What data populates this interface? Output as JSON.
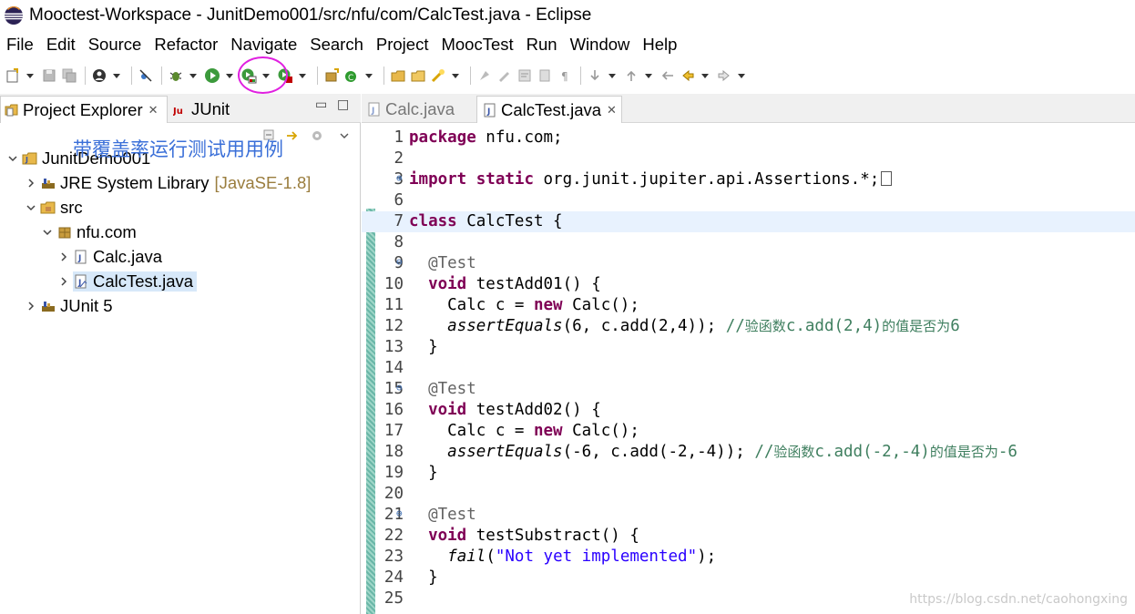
{
  "window": {
    "title": "Mooctest-Workspace - JunitDemo001/src/nfu/com/CalcTest.java - Eclipse"
  },
  "menu": [
    "File",
    "Edit",
    "Source",
    "Refactor",
    "Navigate",
    "Search",
    "Project",
    "MoocTest",
    "Run",
    "Window",
    "Help"
  ],
  "left_view": {
    "tabs": {
      "project_explorer": "Project Explorer",
      "junit": "JUnit"
    },
    "annotation": "带覆盖率运行测试用用例",
    "tree": {
      "project": "JunitDemo001",
      "jre": "JRE System Library",
      "jre_decor": "[JavaSE-1.8]",
      "src": "src",
      "package": "nfu.com",
      "file1": "Calc.java",
      "file2": "CalcTest.java",
      "junit5": "JUnit 5"
    }
  },
  "editor": {
    "tabs": {
      "calc": "Calc.java",
      "calctest": "CalcTest.java"
    },
    "lines": [
      {
        "n": "1",
        "fold": "",
        "t": [
          [
            "kw",
            "package"
          ],
          [
            "",
            "  nfu.com;"
          ]
        ]
      },
      {
        "n": "2",
        "fold": "",
        "t": []
      },
      {
        "n": "3",
        "fold": "⊕",
        "t": [
          [
            "kw",
            "import"
          ],
          [
            "",
            "  "
          ],
          [
            "kw",
            "static"
          ],
          [
            "",
            "  org.junit.jupiter.api.Assertions.*;"
          ]
        ],
        "marker": true
      },
      {
        "n": "6",
        "fold": "",
        "t": []
      },
      {
        "n": "7",
        "fold": "",
        "t": [
          [
            "kw",
            "class"
          ],
          [
            "",
            "  CalcTest {"
          ]
        ],
        "current": true
      },
      {
        "n": "8",
        "fold": "",
        "t": []
      },
      {
        "n": "9",
        "fold": "⊖",
        "t": [
          [
            "",
            "    "
          ],
          [
            "ann",
            "@Test"
          ]
        ]
      },
      {
        "n": "10",
        "fold": "",
        "t": [
          [
            "",
            "    "
          ],
          [
            "kw",
            "void"
          ],
          [
            "",
            "  testAdd01() {"
          ]
        ]
      },
      {
        "n": "11",
        "fold": "",
        "t": [
          [
            "",
            "        Calc c = "
          ],
          [
            "kw",
            "new"
          ],
          [
            "",
            "  Calc();"
          ]
        ]
      },
      {
        "n": "12",
        "fold": "",
        "t": [
          [
            "",
            "        "
          ],
          [
            "it",
            "assertEquals"
          ],
          [
            "",
            "(6, c.add(2,4));  "
          ],
          [
            "cm",
            "//"
          ],
          [
            "cm cm-cjk",
            "验函数"
          ],
          [
            "cm",
            "c.add(2,4)"
          ],
          [
            "cm cm-cjk",
            "的值是否为"
          ],
          [
            "cm",
            "6"
          ]
        ]
      },
      {
        "n": "13",
        "fold": "",
        "t": [
          [
            "",
            "    }"
          ]
        ]
      },
      {
        "n": "14",
        "fold": "",
        "t": []
      },
      {
        "n": "15",
        "fold": "⊖",
        "t": [
          [
            "",
            "    "
          ],
          [
            "ann",
            "@Test"
          ]
        ]
      },
      {
        "n": "16",
        "fold": "",
        "t": [
          [
            "",
            "    "
          ],
          [
            "kw",
            "void"
          ],
          [
            "",
            "  testAdd02() {"
          ]
        ]
      },
      {
        "n": "17",
        "fold": "",
        "t": [
          [
            "",
            "        Calc c = "
          ],
          [
            "kw",
            "new"
          ],
          [
            "",
            "  Calc();"
          ]
        ]
      },
      {
        "n": "18",
        "fold": "",
        "t": [
          [
            "",
            "        "
          ],
          [
            "it",
            "assertEquals"
          ],
          [
            "",
            "(-6, c.add(-2,-4));  "
          ],
          [
            "cm",
            "//"
          ],
          [
            "cm cm-cjk",
            "验函数"
          ],
          [
            "cm",
            "c.add(-2,-4)"
          ],
          [
            "cm cm-cjk",
            "的值是否为"
          ],
          [
            "cm",
            "-6"
          ]
        ]
      },
      {
        "n": "19",
        "fold": "",
        "t": [
          [
            "",
            "    }"
          ]
        ]
      },
      {
        "n": "20",
        "fold": "",
        "t": []
      },
      {
        "n": "21",
        "fold": "⊖",
        "t": [
          [
            "",
            "    "
          ],
          [
            "ann",
            "@Test"
          ]
        ]
      },
      {
        "n": "22",
        "fold": "",
        "t": [
          [
            "",
            "    "
          ],
          [
            "kw",
            "void"
          ],
          [
            "",
            "  testSubstract() {"
          ]
        ]
      },
      {
        "n": "23",
        "fold": "",
        "t": [
          [
            "",
            "        "
          ],
          [
            "it",
            "fail"
          ],
          [
            "",
            "("
          ],
          [
            "str",
            "\"Not yet implemented\""
          ],
          [
            "",
            ");"
          ]
        ]
      },
      {
        "n": "24",
        "fold": "",
        "t": [
          [
            "",
            "    }"
          ]
        ]
      },
      {
        "n": "25",
        "fold": "",
        "t": []
      }
    ]
  },
  "watermark": "https://blog.csdn.net/caohongxing",
  "colors": {
    "keyword": "#7f0055",
    "annotation": "#646464",
    "string": "#2a00ff",
    "comment": "#3f7f5f",
    "highlight_circle": "#e020e0",
    "annotation_text": "#3a6fd8"
  }
}
